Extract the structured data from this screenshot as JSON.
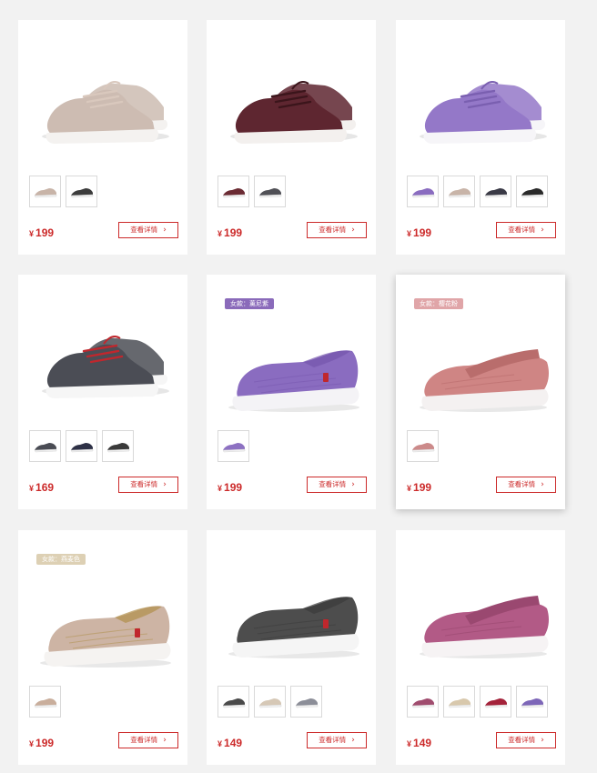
{
  "cards": [
    {
      "price": "199",
      "currency": "¥",
      "button_label": "查看详情",
      "badge": "",
      "thumb_colors": [
        "#c8b4a8",
        "#3c3c3c"
      ],
      "shoe_color": "#cdbcb2",
      "sole_color": "#f4f2f0",
      "lace_color": "#d9c8bd",
      "shoe_style": "sneaker"
    },
    {
      "price": "199",
      "currency": "¥",
      "button_label": "查看详情",
      "badge": "",
      "thumb_colors": [
        "#6b2b33",
        "#505056"
      ],
      "shoe_color": "#5e2630",
      "sole_color": "#f3f0ee",
      "lace_color": "#3b151b",
      "shoe_style": "sneaker"
    },
    {
      "price": "199",
      "currency": "¥",
      "button_label": "查看详情",
      "badge": "",
      "thumb_colors": [
        "#8a6cc0",
        "#c8b4a8",
        "#3a3a46",
        "#2a2a2a"
      ],
      "shoe_color": "#9478c8",
      "sole_color": "#f6f5f8",
      "lace_color": "#7a5fb0",
      "shoe_style": "sneaker"
    },
    {
      "price": "169",
      "currency": "¥",
      "button_label": "查看详情",
      "badge": "",
      "thumb_colors": [
        "#4a4c54",
        "#2e3146",
        "#3a3a3a"
      ],
      "shoe_color": "#4b4d55",
      "sole_color": "#f6f6f6",
      "lace_color": "#c0272d",
      "shoe_style": "sneaker"
    },
    {
      "price": "199",
      "currency": "¥",
      "button_label": "查看详情",
      "badge": "女款：薰尼紫",
      "badge_color": "#8a6aba",
      "thumb_colors": [
        "#8d71c2"
      ],
      "shoe_color": "#8a6cc0",
      "sole_color": "#f4f3f6",
      "lace_color": "#7556ad",
      "shoe_style": "slipon"
    },
    {
      "price": "199",
      "currency": "¥",
      "button_label": "查看详情",
      "badge": "女款：樱花粉",
      "badge_color": "#e0a5a8",
      "thumb_colors": [
        "#cc8a8a"
      ],
      "shoe_color": "#cf8584",
      "sole_color": "#f4f1f1",
      "lace_color": "#b96d6c",
      "shoe_style": "strap"
    },
    {
      "price": "199",
      "currency": "¥",
      "button_label": "查看详情",
      "badge": "女款：燕麦色",
      "badge_color": "#ddd0b4",
      "thumb_colors": [
        "#c9ae9c"
      ],
      "shoe_color": "#cdb4a4",
      "sole_color": "#f5f3f1",
      "lace_color": "#b08f4a",
      "shoe_style": "slipon"
    },
    {
      "price": "149",
      "currency": "¥",
      "button_label": "查看详情",
      "badge": "",
      "thumb_colors": [
        "#4a4a4a",
        "#d6c8b6",
        "#8c8e98"
      ],
      "shoe_color": "#4d4d4d",
      "sole_color": "#f5f5f5",
      "lace_color": "#3a3a3a",
      "shoe_style": "slipon"
    },
    {
      "price": "149",
      "currency": "¥",
      "button_label": "查看详情",
      "badge": "",
      "thumb_colors": [
        "#a04c6e",
        "#d8c8ac",
        "#a4223a",
        "#7d66b8"
      ],
      "shoe_color": "#b25a86",
      "sole_color": "#f6f3f4",
      "lace_color": "#9a4870",
      "shoe_style": "strap"
    }
  ]
}
